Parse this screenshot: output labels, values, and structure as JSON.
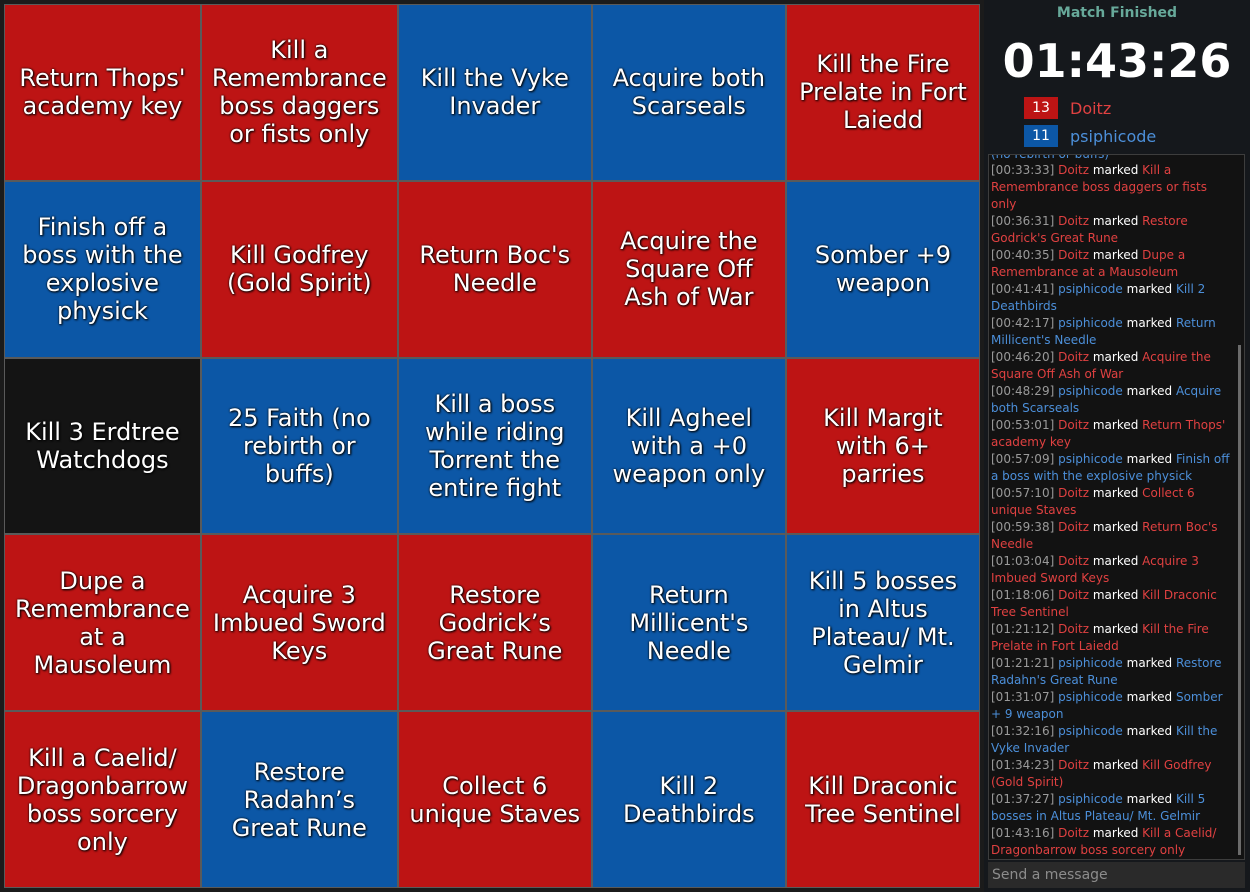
{
  "colors": {
    "red": "#bd1414",
    "blue": "#0c57a6",
    "black": "#141414"
  },
  "board": {
    "cells": [
      {
        "label": "Return Thops' academy key",
        "color": "red",
        "star": false
      },
      {
        "label": "Kill a Remembrance boss daggers or fists only",
        "color": "red",
        "star": false
      },
      {
        "label": "Kill the Vyke Invader",
        "color": "blue",
        "star": false
      },
      {
        "label": "Acquire both Scarseals",
        "color": "blue",
        "star": false
      },
      {
        "label": "Kill the Fire Prelate in Fort Laiedd",
        "color": "red",
        "star": true
      },
      {
        "label": "Finish off a boss with the explosive physick",
        "color": "blue",
        "star": false
      },
      {
        "label": "Kill Godfrey (Gold Spirit)",
        "color": "red",
        "star": true
      },
      {
        "label": "Return Boc's Needle",
        "color": "red",
        "star": false
      },
      {
        "label": "Acquire the Square Off Ash of War",
        "color": "red",
        "star": false
      },
      {
        "label": "Somber +9 weapon",
        "color": "blue",
        "star": false
      },
      {
        "label": "Kill 3 Erdtree Watchdogs",
        "color": "black",
        "star": false
      },
      {
        "label": "25 Faith (no rebirth or buffs)",
        "color": "blue",
        "star": false
      },
      {
        "label": "Kill a boss while riding Torrent the entire fight",
        "color": "blue",
        "star": false
      },
      {
        "label": "Kill Agheel with a +0 weapon only",
        "color": "blue",
        "star": false
      },
      {
        "label": "Kill Margit with 6+ parries",
        "color": "red",
        "star": false
      },
      {
        "label": "Dupe a Remembrance at a Mausoleum",
        "color": "red",
        "star": false
      },
      {
        "label": "Acquire 3 Imbued Sword Keys",
        "color": "red",
        "star": false
      },
      {
        "label": "Restore Godrick’s Great Rune",
        "color": "red",
        "star": false
      },
      {
        "label": "Return Millicent's Needle",
        "color": "blue",
        "star": false
      },
      {
        "label": "Kill 5 bosses in Altus Plateau/ Mt. Gelmir",
        "color": "blue",
        "star": true
      },
      {
        "label": "Kill a Caelid/ Dragonbarrow boss sorcery only",
        "color": "red",
        "star": false
      },
      {
        "label": "Restore Radahn’s Great Rune",
        "color": "blue",
        "star": true
      },
      {
        "label": "Collect 6 unique Staves",
        "color": "red",
        "star": false
      },
      {
        "label": "Kill 2 Deathbirds",
        "color": "blue",
        "star": false
      },
      {
        "label": "Kill Draconic Tree Sentinel",
        "color": "red",
        "star": true
      }
    ]
  },
  "sidebar": {
    "status": "Match Finished",
    "timer": "01:43:26",
    "teams": [
      {
        "score": "13",
        "name": "Doitz",
        "color": "#bd1414",
        "text_color": "#e04141"
      },
      {
        "score": "11",
        "name": "psiphicode",
        "color": "#0c57a6",
        "text_color": "#4c8fd9"
      }
    ]
  },
  "log": {
    "clipped_top": "(no rebirth or buffs)",
    "verb": "marked",
    "entries": [
      {
        "time": "[00:33:33]",
        "player": "Doitz",
        "team": "red",
        "goal": "Kill a Remembrance boss daggers or fists only"
      },
      {
        "time": "[00:36:31]",
        "player": "Doitz",
        "team": "red",
        "goal": "Restore Godrick's Great Rune"
      },
      {
        "time": "[00:40:35]",
        "player": "Doitz",
        "team": "red",
        "goal": "Dupe a Remembrance at a Mausoleum"
      },
      {
        "time": "[00:41:41]",
        "player": "psiphicode",
        "team": "blue",
        "goal": "Kill 2 Deathbirds"
      },
      {
        "time": "[00:42:17]",
        "player": "psiphicode",
        "team": "blue",
        "goal": "Return Millicent's Needle"
      },
      {
        "time": "[00:46:20]",
        "player": "Doitz",
        "team": "red",
        "goal": "Acquire the Square Off Ash of War"
      },
      {
        "time": "[00:48:29]",
        "player": "psiphicode",
        "team": "blue",
        "goal": "Acquire both Scarseals"
      },
      {
        "time": "[00:53:01]",
        "player": "Doitz",
        "team": "red",
        "goal": "Return Thops' academy key"
      },
      {
        "time": "[00:57:09]",
        "player": "psiphicode",
        "team": "blue",
        "goal": "Finish off a boss with the explosive physick"
      },
      {
        "time": "[00:57:10]",
        "player": "Doitz",
        "team": "red",
        "goal": "Collect 6 unique Staves"
      },
      {
        "time": "[00:59:38]",
        "player": "Doitz",
        "team": "red",
        "goal": "Return Boc's Needle"
      },
      {
        "time": "[01:03:04]",
        "player": "Doitz",
        "team": "red",
        "goal": "Acquire 3 Imbued Sword Keys"
      },
      {
        "time": "[01:18:06]",
        "player": "Doitz",
        "team": "red",
        "goal": "Kill Draconic Tree Sentinel"
      },
      {
        "time": "[01:21:12]",
        "player": "Doitz",
        "team": "red",
        "goal": "Kill the Fire Prelate in Fort Laiedd"
      },
      {
        "time": "[01:21:21]",
        "player": "psiphicode",
        "team": "blue",
        "goal": "Restore Radahn's Great Rune"
      },
      {
        "time": "[01:31:07]",
        "player": "psiphicode",
        "team": "blue",
        "goal": "Somber + 9 weapon"
      },
      {
        "time": "[01:32:16]",
        "player": "psiphicode",
        "team": "blue",
        "goal": "Kill the Vyke Invader"
      },
      {
        "time": "[01:34:23]",
        "player": "Doitz",
        "team": "red",
        "goal": "Kill Godfrey (Gold Spirit)"
      },
      {
        "time": "[01:37:27]",
        "player": "psiphicode",
        "team": "blue",
        "goal": "Kill 5 bosses in Altus Plateau/ Mt. Gelmir"
      },
      {
        "time": "[01:43:16]",
        "player": "Doitz",
        "team": "red",
        "goal": "Kill a Caelid/ Dragonbarrow boss sorcery only"
      }
    ]
  },
  "chat": {
    "placeholder": "Send a message"
  }
}
